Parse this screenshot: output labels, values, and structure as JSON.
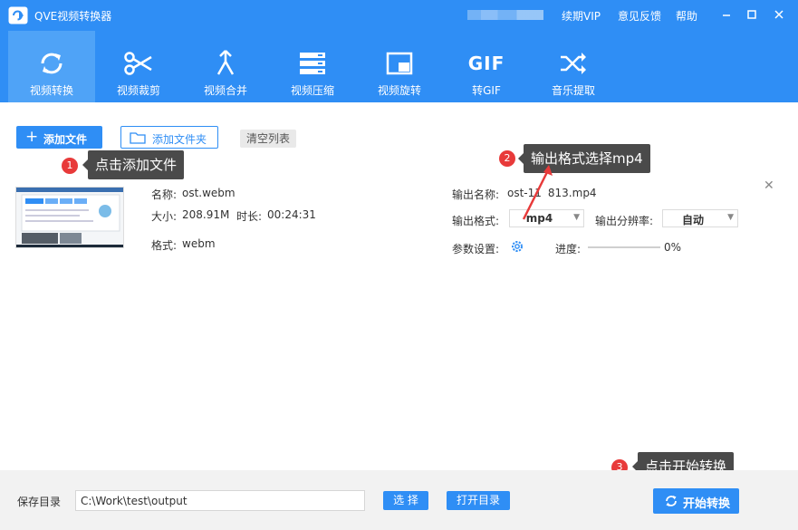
{
  "app": {
    "title": "QVE视频转换器",
    "top_links": [
      "续期VIP",
      "意见反馈",
      "帮助"
    ]
  },
  "toolbar": {
    "tools": [
      {
        "label": "视频转换",
        "icon": "convert-icon"
      },
      {
        "label": "视频裁剪",
        "icon": "scissors-icon"
      },
      {
        "label": "视频合并",
        "icon": "merge-icon"
      },
      {
        "label": "视频压缩",
        "icon": "compress-icon"
      },
      {
        "label": "视频旋转",
        "icon": "rotate-icon"
      },
      {
        "label": "转GIF",
        "icon": "gif-icon",
        "icon_text": "GIF"
      },
      {
        "label": "音乐提取",
        "icon": "shuffle-icon"
      }
    ],
    "active_index": 0
  },
  "actions": {
    "add_file": "添加文件",
    "add_folder": "添加文件夹",
    "clear_list": "清空列表"
  },
  "file": {
    "name_label": "名称:",
    "name": "ost.webm",
    "size_label": "大小:",
    "size": "208.91M",
    "duration_label": "时长:",
    "duration": "00:24:31",
    "format_label": "格式:",
    "format": "webm",
    "output_name_label": "输出名称:",
    "output_name": "ost-11",
    "output_name_tail": "813.mp4",
    "output_format_label": "输出格式:",
    "output_format": "mp4",
    "resolution_label": "输出分辨率:",
    "resolution": "自动",
    "params_label": "参数设置:",
    "progress_label": "进度:",
    "progress_value": 0,
    "progress_text": "0%"
  },
  "annotations": [
    {
      "number": "1",
      "text": "点击添加文件"
    },
    {
      "number": "2",
      "text": "输出格式选择mp4"
    },
    {
      "number": "3",
      "text": "点击开始转换"
    }
  ],
  "bottom": {
    "save_dir_label": "保存目录",
    "save_dir": "C:\\Work\\test\\output",
    "choose": "选 择",
    "open_dir": "打开目录",
    "start": "开始转换"
  },
  "colors": {
    "primary": "#2f8ef5",
    "active_tab": "#4fa3f7",
    "annotation_red": "#e83a3a",
    "callout_bg": "#4a4a4a"
  }
}
